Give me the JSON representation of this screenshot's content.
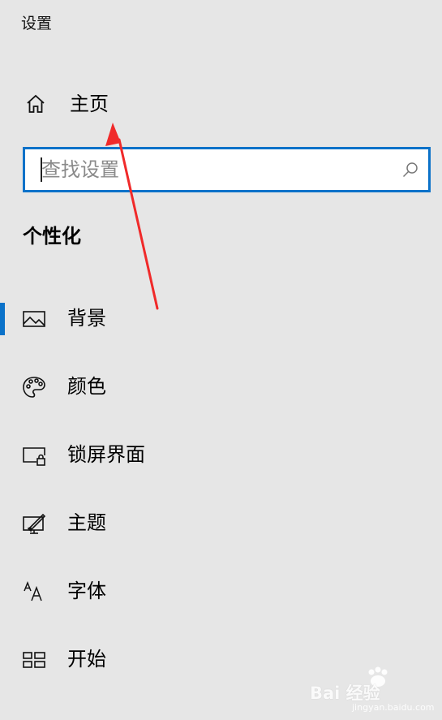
{
  "window": {
    "title": "设置"
  },
  "home": {
    "label": "主页",
    "icon": "home-icon"
  },
  "search": {
    "placeholder": "查找设置",
    "value": "",
    "icon": "search-icon"
  },
  "section": {
    "title": "个性化"
  },
  "nav": {
    "items": [
      {
        "label": "背景",
        "icon": "image-icon",
        "active": true
      },
      {
        "label": "颜色",
        "icon": "palette-icon",
        "active": false
      },
      {
        "label": "锁屏界面",
        "icon": "lock-screen-icon",
        "active": false
      },
      {
        "label": "主题",
        "icon": "theme-icon",
        "active": false
      },
      {
        "label": "字体",
        "icon": "font-icon",
        "active": false
      },
      {
        "label": "开始",
        "icon": "start-icon",
        "active": false
      }
    ]
  },
  "annotation": {
    "arrow_color": "#f02a2a"
  },
  "watermark": {
    "text": "Bai 经验",
    "subtext": "jingyan.baidu.com"
  },
  "colors": {
    "accent": "#0b72c9",
    "background": "#e6e6e6"
  }
}
